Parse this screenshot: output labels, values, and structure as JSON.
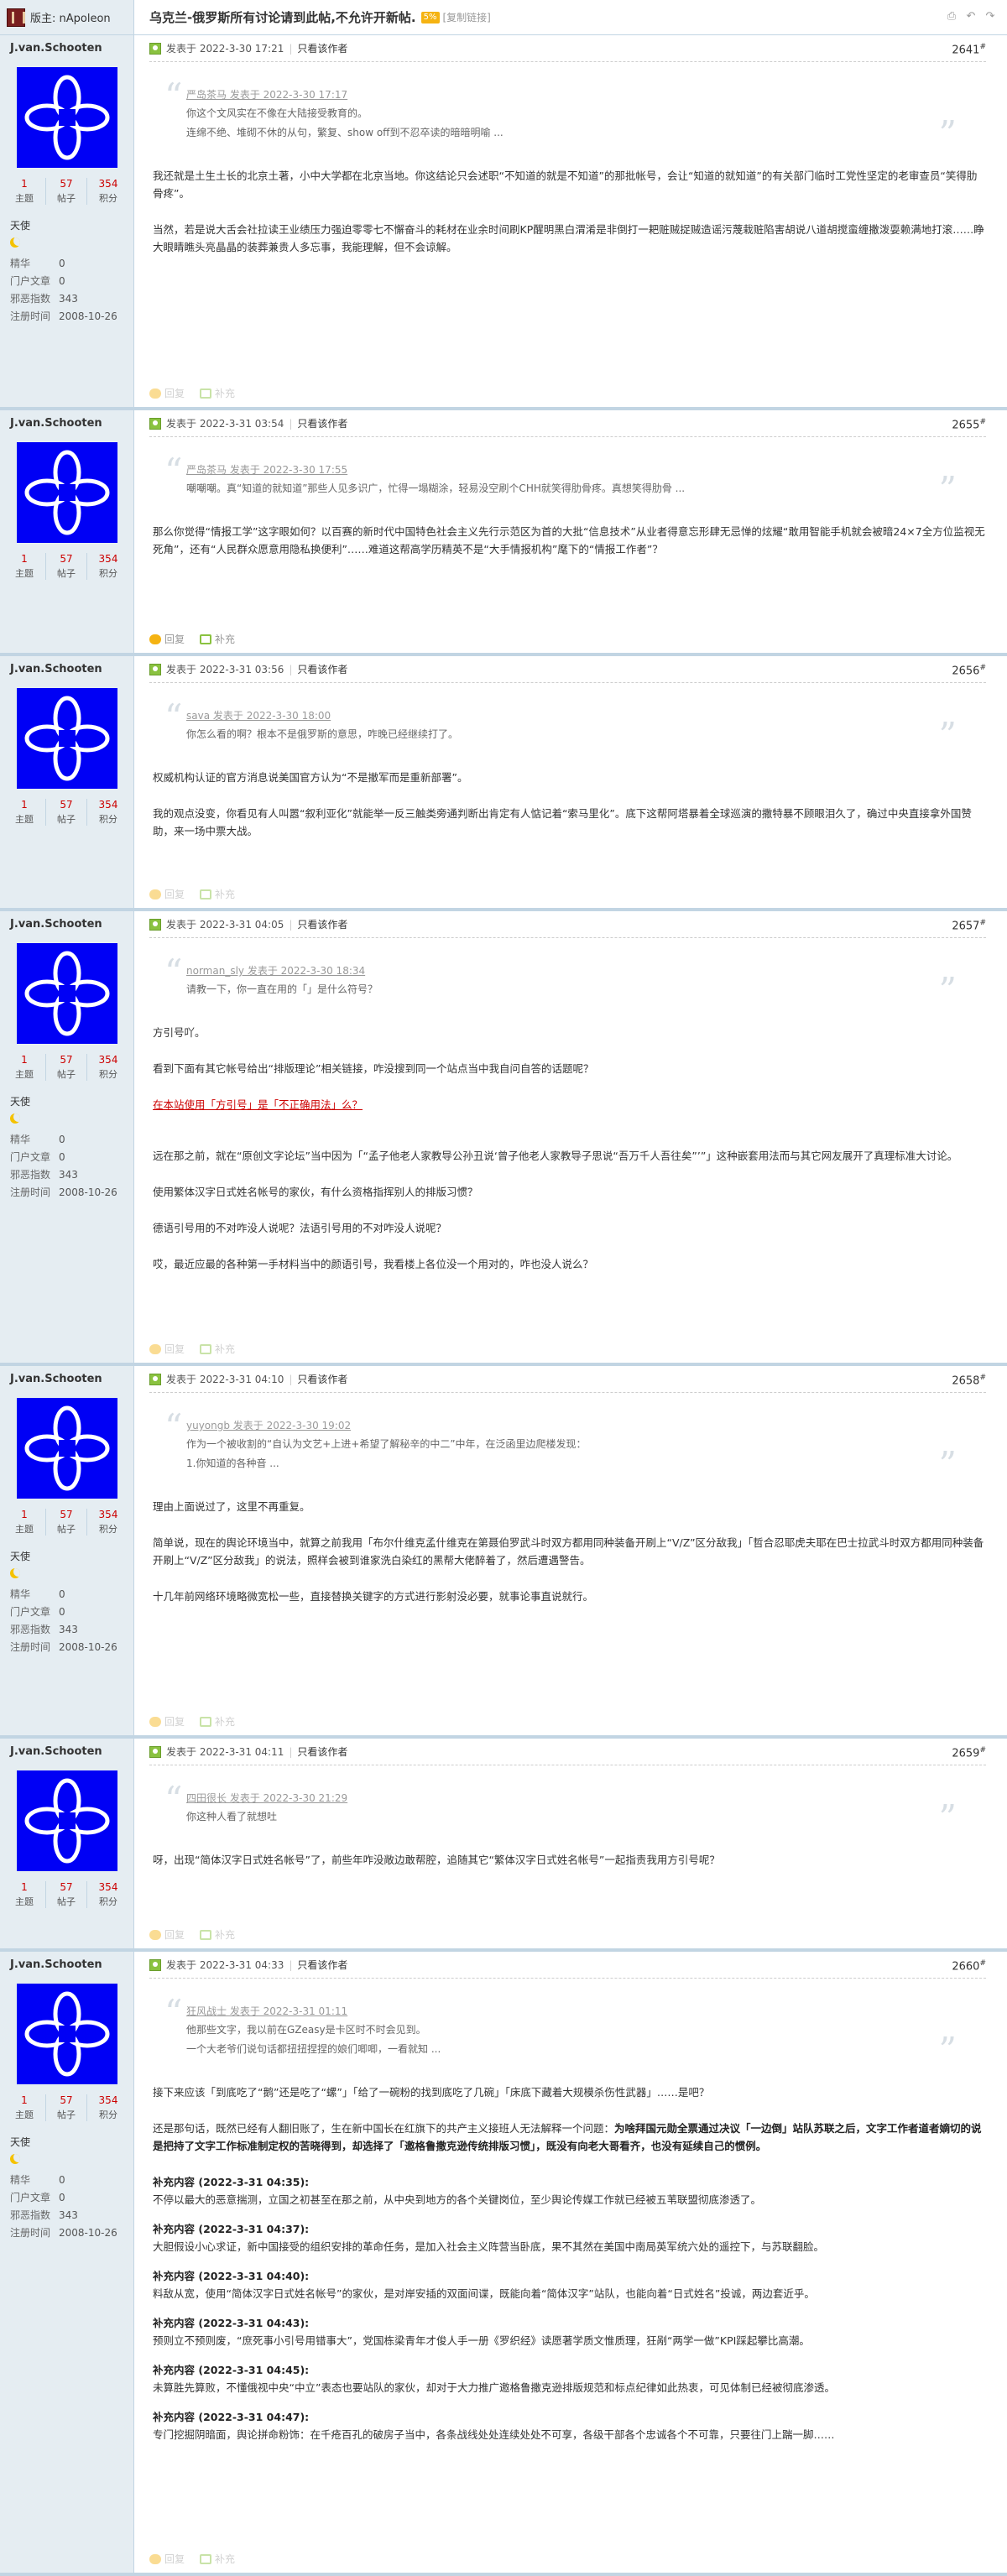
{
  "header": {
    "moderator": "版主: nApoleon",
    "title": "乌克兰-俄罗斯所有讨论请到此帖,不允许开新帖.",
    "badge": "5%",
    "copy_link": "[复制链接]"
  },
  "labels": {
    "posted_prefix": "发表于",
    "author_only": "只看该作者",
    "posts": "主题",
    "topics": "帖子",
    "points": "积分",
    "reply": "回复",
    "supplement": "补充",
    "rank": "天使",
    "k_jinghua": "精华",
    "k_menhu": "门户文章",
    "k_xie": "邪恶指数",
    "k_reg": "注册时间"
  },
  "user": {
    "name": "J.van.Schooten",
    "stat1": "1",
    "stat2": "57",
    "stat3": "354",
    "jinghua": "0",
    "menhu": "0",
    "xie": "343",
    "reg": "2008-10-26"
  },
  "colors": {
    "avatar_bg": "#0000f5",
    "border": "#c2d5e3",
    "side_bg": "#e5edf2",
    "stat": "#cc0000"
  },
  "posts": [
    {
      "time": "2022-3-30 17:21",
      "floor": "2641",
      "quote_head": "严岛茶马 发表于 2022-3-30 17:17",
      "quote_lines": [
        "你这个文风实在不像在大陆接受教育的。",
        "连绵不绝、堆砌不休的从句，繁复、show off到不忍卒读的暗暗明喻 ..."
      ],
      "body": [
        "我还就是土生土长的北京土著，小中大学都在北京当地。你这结论只会述职“不知道的就是不知道”的那批帐号，会让“知道的就知道”的有关部门临时工党性坚定的老审查员“笑得肋骨疼”。",
        "当然，若是说大舌会社拉读王业绩压力强迫零零七不懈奋斗的耗材在业余时间刷KP醒明黑白渭淆是非倒打一耙赃贼捉贼造谣污蔑栽赃陷害胡说八道胡搅蛮缠撒泼耍赖满地打滚……睁大眼睛瞧头亮晶晶的装葬兼贵人多忘事，我能理解，但不会谅解。"
      ]
    },
    {
      "time": "2022-3-31 03:54",
      "floor": "2655",
      "quote_head": "严岛茶马 发表于 2022-3-30 17:55",
      "quote_lines": [
        "嘲嘲嘲。真“知道的就知道”那些人见多识广，忙得一塌糊涂，轻易没空刷个CHH就笑得肋骨疼。真想笑得肋骨 ..."
      ],
      "body": [
        "那么你觉得“情报工学”这字眼如何？以百赛的新时代中国特色社会主义先行示范区为首的大批“信息技术”从业者得意忘形肆无忌惮的炫耀“敢用智能手机就会被暗24×7全方位监视无死角”，还有“人民群众愿意用隐私换便利”……难道这帮高学历精英不是“大手情报机构”麾下的“情报工作者”？"
      ]
    },
    {
      "time": "2022-3-31 03:56",
      "floor": "2656",
      "quote_head": "sava 发表于 2022-3-30 18:00",
      "quote_lines": [
        "你怎么看的啊？根本不是俄罗斯的意思，咋晚已经继续打了。"
      ],
      "body": [
        "权威机构认证的官方消息说美国官方认为“不是撤军而是重新部署”。",
        "我的观点没变，你看见有人叫嚣“叙利亚化”就能举一反三触类旁通判断出肯定有人惦记着“索马里化”。底下这帮阿塔暴着全球巡演的撒特暴不顾眼泪久了，确过中央直接拿外国赞助，来一场中票大战。"
      ]
    },
    {
      "time": "2022-3-31 04:05",
      "floor": "2657",
      "quote_head": "norman_sly 发表于 2022-3-30 18:34",
      "quote_lines": [
        "请教一下，你一直在用的「」是什么符号？"
      ],
      "body_a": [
        "方引号吖。",
        "看到下面有其它帐号给出“排版理论”相关链接，咋没搜到同一个站点当中我自问自答的话题呢？"
      ],
      "link": "在本站使用「方引号」是「不正确用法」么？",
      "body_b": [
        "远在那之前，就在“原创文字论坛”当中因为「“孟子他老人家教导公孙丑说‘曾子他老人家教导子思说“吾万千人吾往矣”’”」这种嵌套用法而与其它网友展开了真理标准大讨论。",
        "使用繁体汉字日式姓名帐号的家伙，有什么资格指挥别人的排版习惯？",
        "德语引号用的不对咋没人说呢？法语引号用的不对咋没人说呢？",
        "哎，最近应最的各种第一手材料当中的颜语引号，我看楼上各位没一个用对的，咋也没人说么？"
      ]
    },
    {
      "time": "2022-3-31 04:10",
      "floor": "2658",
      "quote_head": "yuyongb 发表于 2022-3-30 19:02",
      "quote_lines": [
        "作为一个被收割的“自认为文艺+上进+希望了解秘辛的中二”中年，在泛函里边爬楼发现：",
        "1.你知道的各种音 ..."
      ],
      "body": [
        "理由上面说过了，这里不再重复。",
        "简单说，现在的舆论环境当中，就算之前我用「布尔什维克孟什维克在第聂伯罗武斗时双方都用同种装备开刷上“V/Z”区分敌我」「哲合忍耶虎夫耶在巴士拉武斗时双方都用同种装备开刷上“V/Z”区分敌我」的说法，照样会被到谁家洗白染红的黑帮大佬醉着了，然后遭遇警告。",
        "十几年前网络环境略微宽松一些，直接替换关键字的方式进行影射没必要，就事论事直说就行。"
      ]
    },
    {
      "time": "2022-3-31 04:11",
      "floor": "2659",
      "quote_head": "四田很长 发表于 2022-3-30 21:29",
      "quote_lines": [
        "你这种人看了就想吐"
      ],
      "body": [
        "呀，出现“简体汉字日式姓名帐号”了，前些年咋没敞边敢帮腔，追随其它“繁体汉字日式姓名帐号”一起指责我用方引号呢？"
      ]
    },
    {
      "time": "2022-3-31 04:33",
      "floor": "2660",
      "quote_head": "狂风战士 发表于 2022-3-31 01:11",
      "quote_lines": [
        "他那些文字，我以前在GZeasy是卡区时不时会见到。",
        "一个大老爷们说句话都扭扭捏捏的娘们唧唧，一看就知 ..."
      ],
      "body_a": [
        "接下来应该「到底吃了“鹅”还是吃了“螺”」「给了一碗粉的找到底吃了几碗」「床底下藏着大规模杀伤性武器」……是吧？"
      ],
      "body_bold_lead": "还是那句话，既然已经有人翻旧账了，生在新中国长在红旗下的共产主义接班人无法解释一个问题：",
      "body_bold": "为啥拜国元勋全票通过决议「一边倒」站队苏联之后，文字工作者道者嫡切的说是把持了文字工作标准制定权的苦晓得到，却选择了「邀格鲁撒克逊传统排版习惯」，既没有向老大哥看齐，也没有延续自己的惯例。",
      "supp": [
        {
          "h": "补充内容 (2022-3-31 04:35):",
          "t": "不停以最大的恶意揣测，立国之初甚至在那之前，从中央到地方的各个关键岗位，至少舆论传媒工作就已经被五苇联盟彻底渗透了。"
        },
        {
          "h": "补充内容 (2022-3-31 04:37):",
          "t": "大胆假设小心求证，新中国接受的组织安排的革命任务，是加入社会主义阵营当卧底，果不其然在美国中南局英军统六处的遥控下，与苏联翻脸。"
        },
        {
          "h": "补充内容 (2022-3-31 04:40):",
          "t": "料敌从宽，使用“简体汉字日式姓名帐号”的家伙，是对岸安插的双面间谍，既能向着“简体汉字”站队，也能向着“日式姓名”投诚，两边套近乎。"
        },
        {
          "h": "补充内容 (2022-3-31 04:43):",
          "t": "预则立不预则废，“庶死事小引号用错事大”，党国栋梁青年才俊人手一册《罗织经》读愿著学质文惟质理，狂剐“两学一做”KPI踩起攀比高潮。"
        },
        {
          "h": "补充内容 (2022-3-31 04:45):",
          "t": "未算胜先算败，不懂俄视中央“中立”表态也要站队的家伙，却对于大力推广邀格鲁撒克逊排版规范和标点纪律如此热衷，可见体制已经被彻底渗透。"
        },
        {
          "h": "补充内容 (2022-3-31 04:47):",
          "t": "专门挖掘阴暗面，舆论拼命粉饰：在千疮百孔的破房子当中，各条战线处处连续处处不可享，各级干部各个忠诚各个不可靠，只要往门上踹一脚……"
        }
      ]
    }
  ]
}
